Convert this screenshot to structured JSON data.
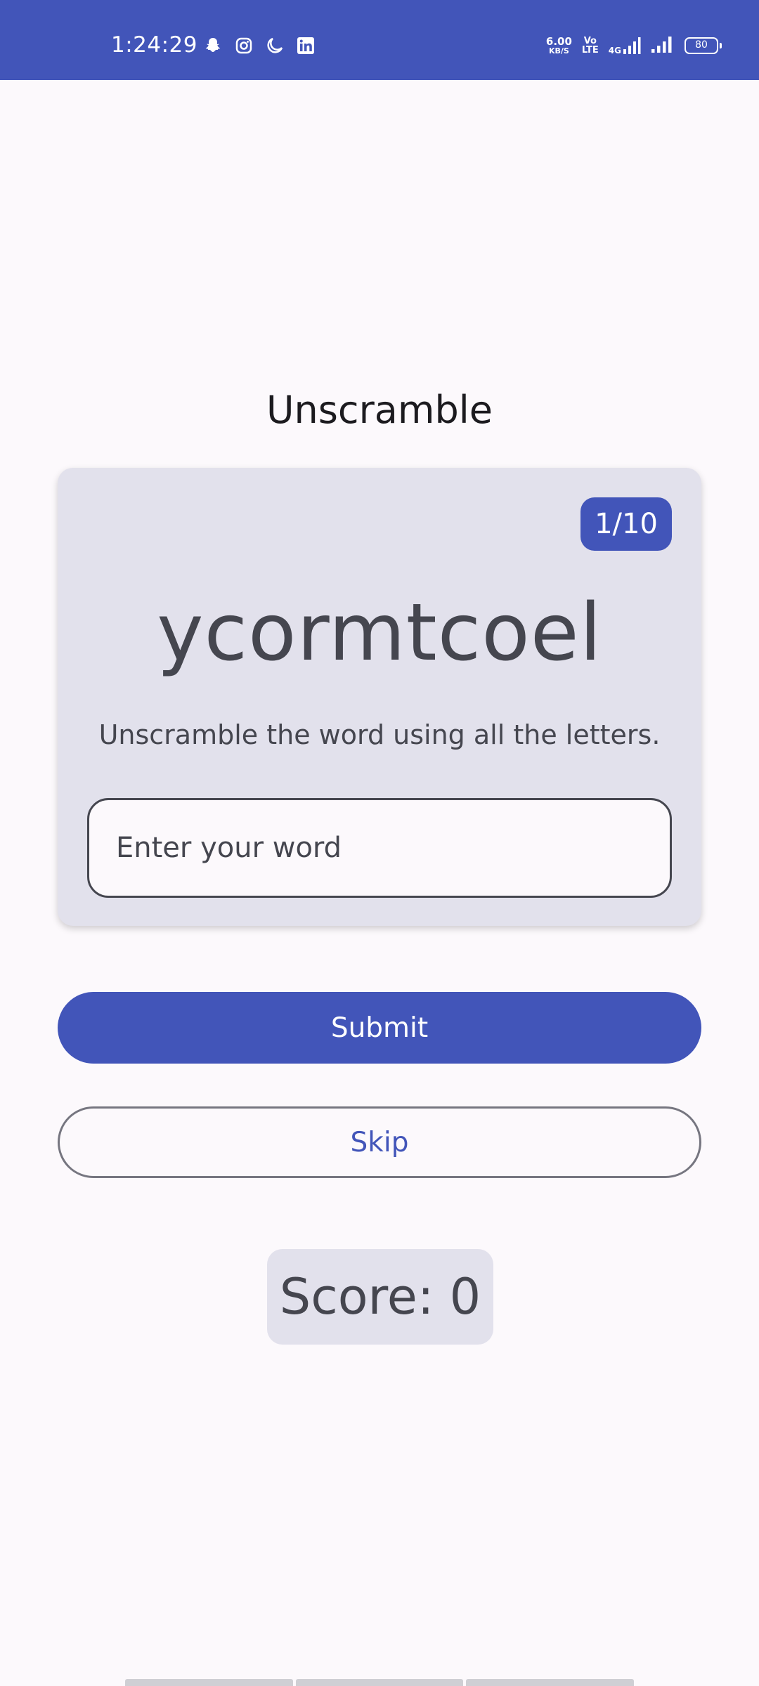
{
  "status_bar": {
    "time": "1:24:29",
    "left_icons": [
      "snapchat-icon",
      "instagram-icon",
      "moon-icon",
      "linkedin-icon"
    ],
    "net_speed_value": "6.00",
    "net_speed_unit": "KB/S",
    "volte_top": "Vo",
    "volte_bottom": "LTE",
    "network_type": "4G",
    "battery": "80"
  },
  "app": {
    "title": "Unscramble",
    "counter": "1/10",
    "scrambled_word": "ycormtcoel",
    "instructions": "Unscramble the word using all the letters.",
    "input_placeholder": "Enter your word",
    "input_value": "",
    "submit_label": "Submit",
    "skip_label": "Skip",
    "score_text": "Score: 0"
  },
  "colors": {
    "primary": "#4255b9",
    "surface_variant": "#e2e1ec",
    "background": "#fcf9fc",
    "on_surface_variant": "#45464f"
  }
}
